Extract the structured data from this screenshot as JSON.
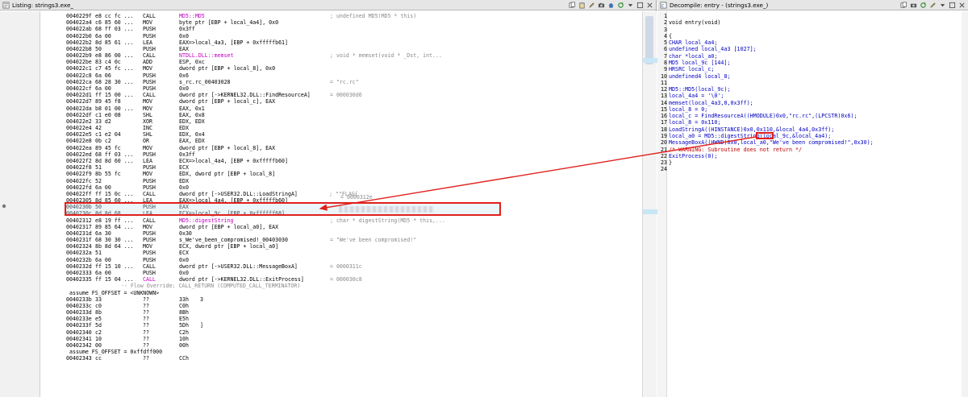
{
  "listing": {
    "title": "Listing:  strings3.exe_",
    "rows": [
      {
        "addr": "0040229f",
        "bytes": "e8 cc fc ...",
        "mnem": "CALL",
        "op": "MD5::MD5",
        "op_kind": "fn",
        "cmt": "; undefined MD5(MD5 * this)"
      },
      {
        "addr": "004022a4",
        "bytes": "c6 85 60 ...",
        "mnem": "MOV",
        "op": "byte ptr [EBP + local_4a4], 0x0",
        "cmt": ""
      },
      {
        "addr": "004022ab",
        "bytes": "68 ff 03 ...",
        "mnem": "PUSH",
        "op": "0x3ff",
        "cmt": ""
      },
      {
        "addr": "004022b0",
        "bytes": "6a 00",
        "mnem": "PUSH",
        "op": "0x0",
        "cmt": ""
      },
      {
        "addr": "004022b2",
        "bytes": "8d 85 61 ...",
        "mnem": "LEA",
        "op": "EAX=>local_4a3, [EBP + 0xfffffb61]",
        "cmt": ""
      },
      {
        "addr": "004022b8",
        "bytes": "50",
        "mnem": "PUSH",
        "op": "EAX",
        "cmt": ""
      },
      {
        "addr": "004022b9",
        "bytes": "e8 86 00 ...",
        "mnem": "CALL",
        "op": "NTDLL.DLL::memset",
        "cmt": "; void * memset(void * _Dst, int..."
      },
      {
        "addr": "004022be",
        "bytes": "83 c4 0c",
        "mnem": "ADD",
        "op": "ESP, 0xc",
        "cmt": ""
      },
      {
        "addr": "004022c1",
        "bytes": "c7 45 fc ...",
        "mnem": "MOV",
        "op": "dword ptr [EBP + local_8], 0x0",
        "cmt": ""
      },
      {
        "addr": "004022c8",
        "bytes": "6a 06",
        "mnem": "PUSH",
        "op": "0x6",
        "cmt": ""
      },
      {
        "addr": "004022ca",
        "bytes": "68 28 30 ...",
        "mnem": "PUSH",
        "op": "s_rc.rc_00403028",
        "cmt": "= \"rc.rc\""
      },
      {
        "addr": "004022cf",
        "bytes": "6a 00",
        "mnem": "PUSH",
        "op": "0x0",
        "cmt": ""
      },
      {
        "addr": "004022d1",
        "bytes": "ff 15 00 ...",
        "mnem": "CALL",
        "op": "dword ptr [->KERNEL32.DLL::FindResourceA]",
        "cmt": "= 000030d6"
      },
      {
        "addr": "004022d7",
        "bytes": "89 45 f8",
        "mnem": "MOV",
        "op": "dword ptr [EBP + local_c], EAX",
        "cmt": ""
      },
      {
        "addr": "004022da",
        "bytes": "b8 01 00 ...",
        "mnem": "MOV",
        "op": "EAX, 0x1",
        "cmt": ""
      },
      {
        "addr": "004022df",
        "bytes": "c1 e0 08",
        "mnem": "SHL",
        "op": "EAX, 0x8",
        "cmt": ""
      },
      {
        "addr": "004022e2",
        "bytes": "33 d2",
        "mnem": "XOR",
        "op": "EDX, EDX",
        "cmt": ""
      },
      {
        "addr": "004022e4",
        "bytes": "42",
        "mnem": "INC",
        "op": "EDX",
        "cmt": ""
      },
      {
        "addr": "004022e5",
        "bytes": "c1 e2 04",
        "mnem": "SHL",
        "op": "EDX, 0x4",
        "cmt": ""
      },
      {
        "addr": "004022e8",
        "bytes": "0b c2",
        "mnem": "OR",
        "op": "EAX, EDX",
        "cmt": ""
      },
      {
        "addr": "004022ea",
        "bytes": "89 45 fc",
        "mnem": "MOV",
        "op": "dword ptr [EBP + local_8], EAX",
        "cmt": ""
      },
      {
        "addr": "004022ed",
        "bytes": "68 ff 03 ...",
        "mnem": "PUSH",
        "op": "0x3ff",
        "cmt": ""
      },
      {
        "addr": "004022f2",
        "bytes": "8d 8d 60 ...",
        "mnem": "LEA",
        "op": "ECX=>local_4a4, [EBP + 0xfffffb60]",
        "cmt": ""
      },
      {
        "addr": "004022f8",
        "bytes": "51",
        "mnem": "PUSH",
        "op": "ECX",
        "cmt": ""
      },
      {
        "addr": "004022f9",
        "bytes": "8b 55 fc",
        "mnem": "MOV",
        "op": "EDX, dword ptr [EBP + local_8]",
        "cmt": ""
      },
      {
        "addr": "004022fc",
        "bytes": "52",
        "mnem": "PUSH",
        "op": "EDX",
        "cmt": ""
      },
      {
        "addr": "004022fd",
        "bytes": "6a 00",
        "mnem": "PUSH",
        "op": "0x0",
        "cmt": ""
      },
      {
        "addr": "004022ff",
        "bytes": "ff 15 0c ...",
        "mnem": "CALL",
        "op": "dword ptr [->USER32.DLL::LoadStringA]",
        "cmt": ""
      },
      {
        "addr": "00402305",
        "bytes": "8d 85 60 ...",
        "mnem": "LEA",
        "op": "EAX=>local_4a4, [EBP + 0xfffffb60]",
        "cmt": ""
      },
      {
        "addr": "0040230b",
        "bytes": "50",
        "mnem": "PUSH",
        "op": "EAX",
        "cmt": ""
      },
      {
        "addr": "0040230c",
        "bytes": "8d 8d 68 ...",
        "mnem": "LEA",
        "op": "ECX=>local_9c, [EBP + 0xffffff68]",
        "cmt": ""
      },
      {
        "addr": "00402312",
        "bytes": "e8 19 ff ...",
        "mnem": "CALL",
        "op": "MD5::digestString",
        "op_kind": "fn",
        "cmt": "; char * digestString(MD5 * this,..."
      },
      {
        "addr": "00402317",
        "bytes": "89 85 64 ...",
        "mnem": "MOV",
        "op": "dword ptr [EBP + local_a0], EAX",
        "cmt": ""
      },
      {
        "addr": "0040231d",
        "bytes": "6a 30",
        "mnem": "PUSH",
        "op": "0x30",
        "cmt": ""
      },
      {
        "addr": "0040231f",
        "bytes": "68 30 30 ...",
        "mnem": "PUSH",
        "op": "s_We've_been_compromised!_00403030",
        "cmt": "= \"We've been compromised!\""
      },
      {
        "addr": "00402324",
        "bytes": "8b 8d 64 ...",
        "mnem": "MOV",
        "op": "ECX, dword ptr [EBP + local_a0]",
        "cmt": ""
      },
      {
        "addr": "0040232a",
        "bytes": "51",
        "mnem": "PUSH",
        "op": "ECX",
        "cmt": ""
      },
      {
        "addr": "0040232b",
        "bytes": "6a 00",
        "mnem": "PUSH",
        "op": "0x0",
        "cmt": ""
      },
      {
        "addr": "0040232d",
        "bytes": "ff 15 10 ...",
        "mnem": "CALL",
        "op": "dword ptr [->USER32.DLL::MessageBoxA]",
        "cmt": "= 0000311c"
      },
      {
        "addr": "00402333",
        "bytes": "6a 00",
        "mnem": "PUSH",
        "op": "0x0",
        "cmt": ""
      },
      {
        "addr": "00402335",
        "bytes": "ff 15 04 ...",
        "mnem": "CALL",
        "op": "dword ptr [->KERNEL32.DLL::ExitProcess]",
        "cmt": "= 000030c8"
      }
    ],
    "flow_override": "-- Flow Override: CALL_RETURN (COMPUTED_CALL_TERMINATOR)",
    "assume1": "assume FS_OFFSET = <UNKNOWN>",
    "data_rows": [
      {
        "addr": "0040233b",
        "bytes": "33",
        "mnem": "??",
        "op": "33h",
        "extra": "3"
      },
      {
        "addr": "0040233c",
        "bytes": "c0",
        "mnem": "??",
        "op": "C0h",
        "extra": ""
      },
      {
        "addr": "0040233d",
        "bytes": "8b",
        "mnem": "??",
        "op": "8Bh",
        "extra": ""
      },
      {
        "addr": "0040233e",
        "bytes": "e5",
        "mnem": "??",
        "op": "E5h",
        "extra": ""
      },
      {
        "addr": "0040233f",
        "bytes": "5d",
        "mnem": "??",
        "op": "5Dh",
        "extra": "]"
      },
      {
        "addr": "00402340",
        "bytes": "c2",
        "mnem": "??",
        "op": "C2h",
        "extra": ""
      },
      {
        "addr": "00402341",
        "bytes": "10",
        "mnem": "??",
        "op": "10h",
        "extra": ""
      },
      {
        "addr": "00402342",
        "bytes": "00",
        "mnem": "??",
        "op": "00h",
        "extra": ""
      }
    ],
    "assume2": "assume FS_OFFSET = 0xffdff000",
    "last_row": {
      "addr": "00402343",
      "bytes": "cc",
      "mnem": "??",
      "op": "CCh"
    },
    "stray_comment_mid": "= 0000312e",
    "stray_flag_text": "; \"\"FLAG{",
    "hl_mnem_color": "#0000c0"
  },
  "decompile": {
    "title": "Decompile: entry - (strings3.exe_)",
    "lines": [
      "",
      "void entry(void)",
      "",
      "{",
      "  CHAR local_4a4;",
      "  undefined local_4a3 [1027];",
      "  char *local_a0;",
      "  MD5 local_9c [144];",
      "  HRSRC local_c;",
      "  undefined4 local_8;",
      "",
      "  MD5::MD5(local_9c);",
      "  local_4a4 = '\\0';",
      "  memset(local_4a3,0,0x3ff);",
      "  local_8 = 0;",
      "  local_c = FindResourceA((HMODULE)0x0,\"rc.rc\",(LPCSTR)0x6);",
      "  local_8 = 0x110;",
      "  LoadStringA((HINSTANCE)0x0,0x110,&local_4a4,0x3ff);",
      "  local_a0 = MD5::digestString(local_9c,&local_4a4);",
      "  MessageBoxA((HWND)0x0,local_a0,\"We've been compromised!\",0x30);",
      "                    /* WARNING: Subroutine does not return */",
      "  ExitProcess(0);",
      "}",
      ""
    ],
    "highlighted_value": "0x110"
  },
  "icons": {
    "listing_icon": "listing-icon",
    "decompile_icon": "decompile-icon",
    "toolbar": [
      "copy-icon",
      "paste-icon",
      "edit-icon",
      "snapshot-icon",
      "home-icon",
      "refresh-icon",
      "menu-icon",
      "maximize-icon",
      "close-icon"
    ]
  },
  "colors": {
    "highlight_box": "#e0201c",
    "arrow": "#e0201c",
    "function_name": "#c000c0",
    "decomp_keyword": "#0000c0",
    "decomp_string": "#006000",
    "warning": "#c00000"
  }
}
